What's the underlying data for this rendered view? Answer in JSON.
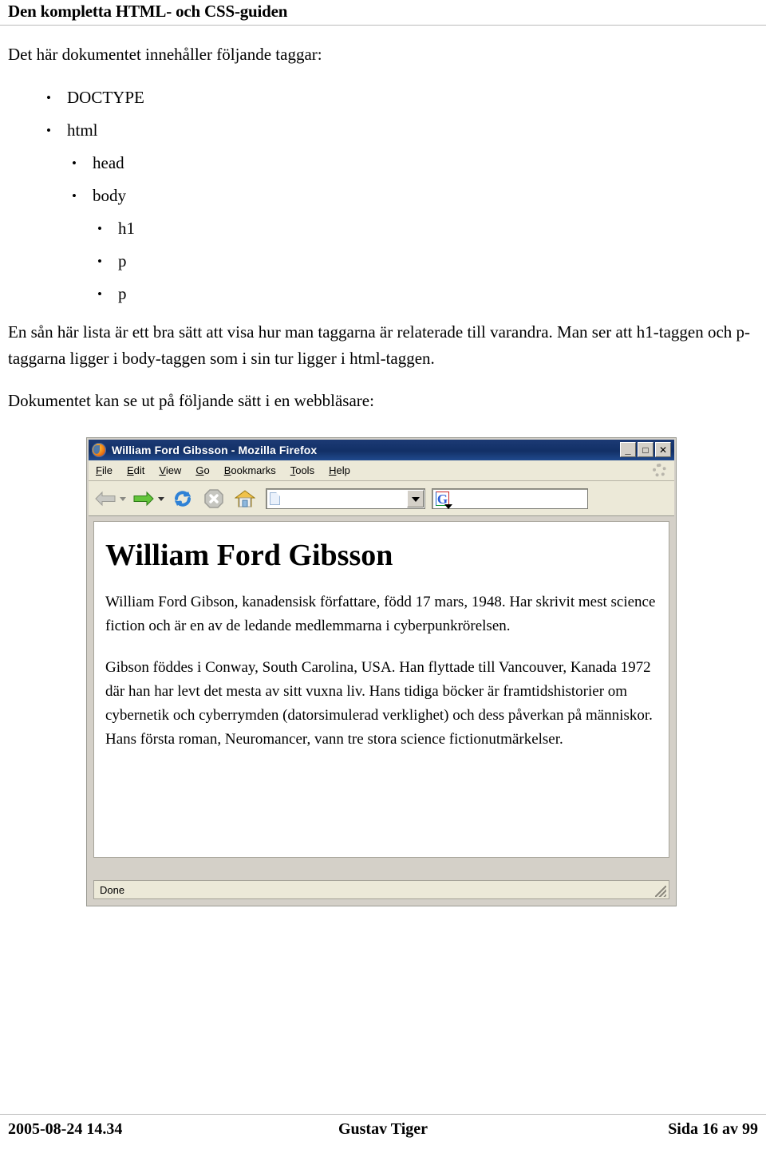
{
  "document": {
    "header_title": "Den kompletta HTML- och CSS-guiden",
    "intro_line": "Det här dokumentet innehåller följande taggar:",
    "tag_list": [
      {
        "label": "DOCTYPE",
        "level": 1,
        "bullet": "•"
      },
      {
        "label": "html",
        "level": 1,
        "bullet": "•"
      },
      {
        "label": "head",
        "level": 2,
        "bullet": "•"
      },
      {
        "label": "body",
        "level": 2,
        "bullet": "•"
      },
      {
        "label": "h1",
        "level": 3,
        "bullet": "•"
      },
      {
        "label": "p",
        "level": 3,
        "bullet": "•"
      },
      {
        "label": "p",
        "level": 3,
        "bullet": "•"
      }
    ],
    "paragraph_explain": "En sån här lista är ett bra sätt att visa hur man taggarna är relaterade till varandra. Man ser att h1-taggen och p-taggarna ligger i body-taggen som i sin tur ligger i html-taggen.",
    "paragraph_browser_intro": "Dokumentet kan se ut på följande sätt i en webbläsare:"
  },
  "browser": {
    "titlebar": {
      "icon": "firefox-icon",
      "title": "William Ford Gibsson - Mozilla Firefox",
      "minimize_label": "_",
      "maximize_label": "□",
      "close_label": "✕"
    },
    "menu": [
      {
        "accel": "F",
        "rest": "ile"
      },
      {
        "accel": "E",
        "rest": "dit"
      },
      {
        "accel": "V",
        "rest": "iew"
      },
      {
        "accel": "G",
        "rest": "o"
      },
      {
        "accel": "B",
        "rest": "ookmarks"
      },
      {
        "accel": "T",
        "rest": "ools"
      },
      {
        "accel": "H",
        "rest": "elp"
      }
    ],
    "toolbar": {
      "back": "back-arrow-icon",
      "forward": "forward-arrow-icon",
      "reload": "reload-icon",
      "stop": "stop-icon",
      "home": "home-icon",
      "url_value": "",
      "url_placeholder": "",
      "search_value": "",
      "search_placeholder": "",
      "search_engine_icon": "google-g-icon"
    },
    "page": {
      "heading": "William Ford Gibsson",
      "paragraph1": "William Ford Gibson, kanadensisk författare, född 17 mars, 1948. Har skrivit mest science fiction och är en av de ledande medlemmarna i cyberpunkrörelsen.",
      "paragraph2": "Gibson föddes i Conway, South Carolina, USA. Han flyttade till Vancouver, Kanada 1972 där han har levt det mesta av sitt vuxna liv. Hans tidiga böcker är framtidshistorier om cybernetik och cyberrymden (datorsimulerad verklighet) och dess påverkan på människor. Hans första roman, Neuromancer, vann tre stora science fictionutmärkelser."
    },
    "statusbar": {
      "text": "Done"
    }
  },
  "footer": {
    "timestamp": "2005-08-24 14.34",
    "author": "Gustav Tiger",
    "page_number": "Sida 16 av 99"
  },
  "colors": {
    "titlebar_blue": "#123066",
    "chrome_grey": "#ece9d8",
    "window_frame": "#d4d0c8",
    "rule_grey": "#bbbbbb",
    "forward_green": "#5ec12a",
    "reload_blue": "#2f82d6"
  }
}
